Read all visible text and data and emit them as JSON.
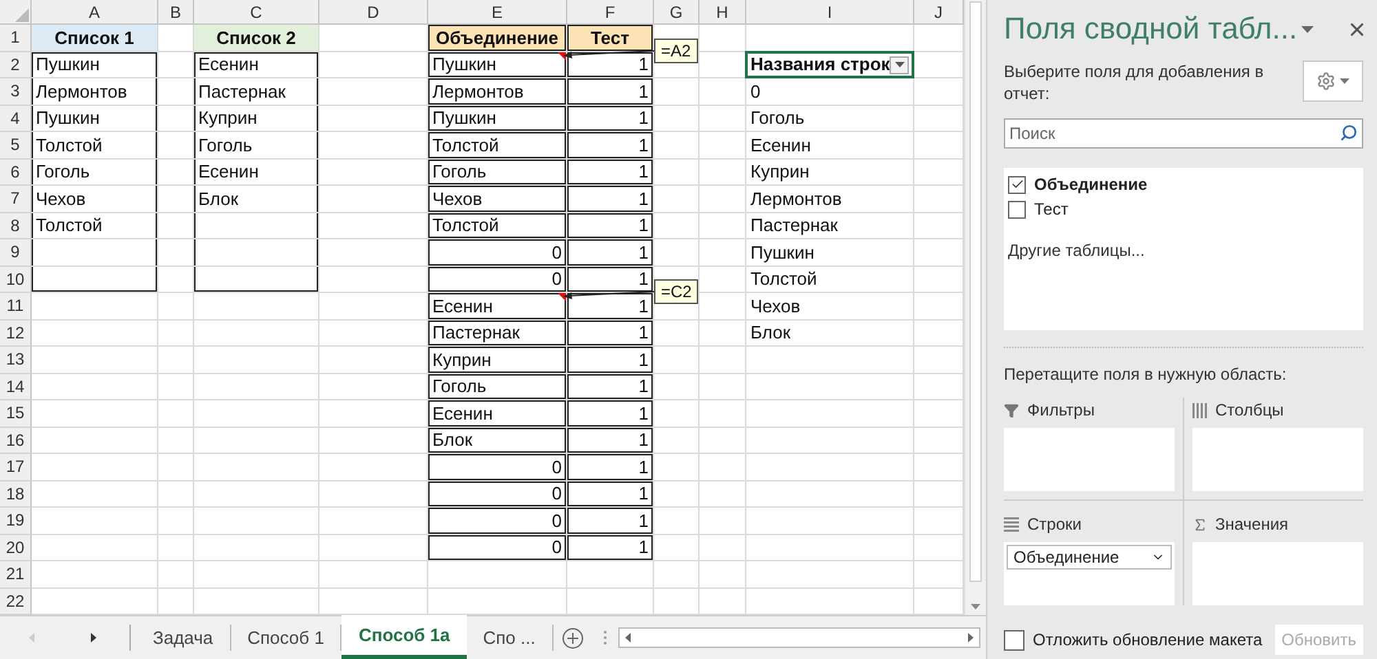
{
  "sheet": {
    "columns": [
      "A",
      "B",
      "C",
      "D",
      "E",
      "F",
      "G",
      "H",
      "I",
      "J"
    ],
    "row_numbers": [
      "1",
      "2",
      "3",
      "4",
      "5",
      "6",
      "7",
      "8",
      "9",
      "10",
      "11",
      "12",
      "13",
      "14",
      "15",
      "16",
      "17",
      "18",
      "19",
      "20",
      "21",
      "22"
    ]
  },
  "list_1": {
    "header": "Список 1",
    "items": [
      "Пушкин",
      "Лермонтов",
      "Пушкин",
      "Толстой",
      "Гоголь",
      "Чехов",
      "Толстой"
    ]
  },
  "list_2": {
    "header": "Список 2",
    "items": [
      "Есенин",
      "Пастернак",
      "Куприн",
      "Гоголь",
      "Есенин",
      "Блок"
    ]
  },
  "union_table": {
    "headers": [
      "Объединение",
      "Тест"
    ],
    "rows": [
      {
        "value": "Пушкин",
        "kind": "text",
        "test": "1",
        "comment": "=A2"
      },
      {
        "value": "Лермонтов",
        "kind": "text",
        "test": "1"
      },
      {
        "value": "Пушкин",
        "kind": "text",
        "test": "1"
      },
      {
        "value": "Толстой",
        "kind": "text",
        "test": "1"
      },
      {
        "value": "Гоголь",
        "kind": "text",
        "test": "1"
      },
      {
        "value": "Чехов",
        "kind": "text",
        "test": "1"
      },
      {
        "value": "Толстой",
        "kind": "text",
        "test": "1"
      },
      {
        "value": "0",
        "kind": "number",
        "test": "1"
      },
      {
        "value": "0",
        "kind": "number",
        "test": "1"
      },
      {
        "value": "Есенин",
        "kind": "text",
        "test": "1",
        "comment": "=C2"
      },
      {
        "value": "Пастернак",
        "kind": "text",
        "test": "1"
      },
      {
        "value": "Куприн",
        "kind": "text",
        "test": "1"
      },
      {
        "value": "Гоголь",
        "kind": "text",
        "test": "1"
      },
      {
        "value": "Есенин",
        "kind": "text",
        "test": "1"
      },
      {
        "value": "Блок",
        "kind": "text",
        "test": "1"
      },
      {
        "value": "0",
        "kind": "number",
        "test": "1"
      },
      {
        "value": "0",
        "kind": "number",
        "test": "1"
      },
      {
        "value": "0",
        "kind": "number",
        "test": "1"
      },
      {
        "value": "0",
        "kind": "number",
        "test": "1"
      }
    ]
  },
  "pivot": {
    "header": "Названия строк",
    "selected": true,
    "items": [
      "0",
      "Гоголь",
      "Есенин",
      "Куприн",
      "Лермонтов",
      "Пастернак",
      "Пушкин",
      "Толстой",
      "Чехов",
      "Блок"
    ]
  },
  "sheet_tabs": [
    {
      "label": "Задача",
      "selected": false
    },
    {
      "label": "Способ 1",
      "selected": false
    },
    {
      "label": "Способ 1а",
      "selected": true
    },
    {
      "label": "Спо ...",
      "selected": false
    }
  ],
  "pivot_pane": {
    "title": "Поля сводной табл...",
    "description": "Выберите поля для добавления в отчет:",
    "search": {
      "placeholder": "Поиск"
    },
    "fields": [
      {
        "label": "Объединение",
        "checked": true
      },
      {
        "label": "Тест",
        "checked": false
      }
    ],
    "more_tables": "Другие таблицы...",
    "areas_hint": "Перетащите поля в нужную область:",
    "areas": [
      {
        "kind": "filters",
        "label": "Фильтры"
      },
      {
        "kind": "columns",
        "label": "Столбцы"
      },
      {
        "kind": "rows",
        "label": "Строки",
        "items": [
          "Объединение"
        ]
      },
      {
        "kind": "values",
        "label": "Значения"
      }
    ],
    "defer": {
      "label": "Отложить обновление макета",
      "checked": false
    },
    "update_button": {
      "label": "Обновить",
      "disabled": true
    }
  }
}
